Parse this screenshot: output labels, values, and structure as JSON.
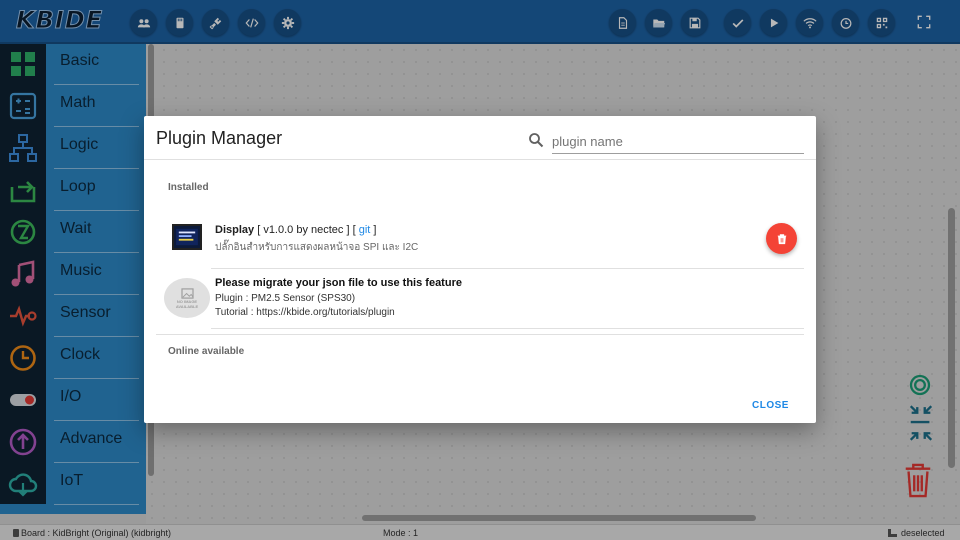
{
  "app": {
    "logo_text": "KBIDE"
  },
  "sidebar": {
    "categories": [
      {
        "label": "Basic",
        "icon": "grid-icon"
      },
      {
        "label": "Math",
        "icon": "calculator-icon"
      },
      {
        "label": "Logic",
        "icon": "hierarchy-icon"
      },
      {
        "label": "Loop",
        "icon": "loop-arrow-icon"
      },
      {
        "label": "Wait",
        "icon": "timer-icon"
      },
      {
        "label": "Music",
        "icon": "music-note-icon"
      },
      {
        "label": "Sensor",
        "icon": "pulse-icon"
      },
      {
        "label": "Clock",
        "icon": "clock-icon"
      },
      {
        "label": "I/O",
        "icon": "toggle-icon"
      },
      {
        "label": "Advance",
        "icon": "up-arrow-circle-icon"
      },
      {
        "label": "IoT",
        "icon": "cloud-icon"
      }
    ]
  },
  "plugin_manager": {
    "title": "Plugin Manager",
    "search_placeholder": "plugin name",
    "installed_label": "Installed",
    "online_label": "Online available",
    "close_label": "CLOSE",
    "plugins": [
      {
        "name": "Display",
        "meta_before": "[ v1.0.0 by nectec ] [",
        "link_label": "git",
        "meta_after": "]",
        "description": "ปลั๊กอินสำหรับการแสดงผลหน้าจอ SPI และ I2C"
      }
    ],
    "migrate_notice": {
      "title": "Please migrate your json file to use this feature",
      "plugin_line": "Plugin : PM2.5 Sensor (SPS30)",
      "tutorial_line": "Tutorial : https://kbide.org/tutorials/plugin",
      "image_text_1": "NO IMAGE",
      "image_text_2": "AVAILABLE"
    }
  },
  "status_bar": {
    "board": "Board : KidBright (Original) (kidbright)",
    "mode": "Mode : 1",
    "selection": "deselected"
  },
  "colors": {
    "topbar": "#1d63a6",
    "sidebar": "#2d89c8",
    "accent_blue": "#1e88e5",
    "delete_red": "#f44336",
    "trash_red": "#e53935",
    "target_green": "#1b9e77"
  }
}
